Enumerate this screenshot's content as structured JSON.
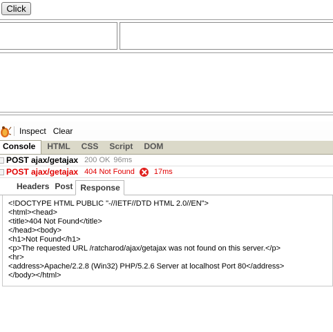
{
  "page": {
    "click_button_label": "Click"
  },
  "firebug": {
    "toolbar": {
      "inspect_label": "Inspect",
      "clear_label": "Clear"
    },
    "tabs": [
      {
        "label": "Console",
        "active": true
      },
      {
        "label": "HTML",
        "active": false
      },
      {
        "label": "CSS",
        "active": false
      },
      {
        "label": "Script",
        "active": false
      },
      {
        "label": "DOM",
        "active": false
      }
    ],
    "requests": [
      {
        "method_url": "POST ajax/getajax",
        "status": "200 OK",
        "time": "96ms",
        "error": false
      },
      {
        "method_url": "POST ajax/getajax",
        "status": "404 Not Found",
        "time": "17ms",
        "error": true
      }
    ],
    "detail_tabs": [
      {
        "label": "Headers",
        "active": false
      },
      {
        "label": "Post",
        "active": false
      },
      {
        "label": "Response",
        "active": true
      }
    ],
    "response_lines": [
      "<!DOCTYPE HTML PUBLIC \"-//IETF//DTD HTML 2.0//EN\">",
      "<html><head>",
      "<title>404 Not Found</title>",
      "</head><body>",
      "<h1>Not Found</h1>",
      "<p>The requested URL /ratcharod/ajax/getajax was not found on this server.</p>",
      "<hr>",
      "<address>Apache/2.2.8 (Win32) PHP/5.2.6 Server at localhost Port 80</address>",
      "</body></html>"
    ]
  },
  "colors": {
    "error_red": "#e00000",
    "tab_bar_bg": "#dbd9c9",
    "muted_gray": "#8a8a8a"
  }
}
